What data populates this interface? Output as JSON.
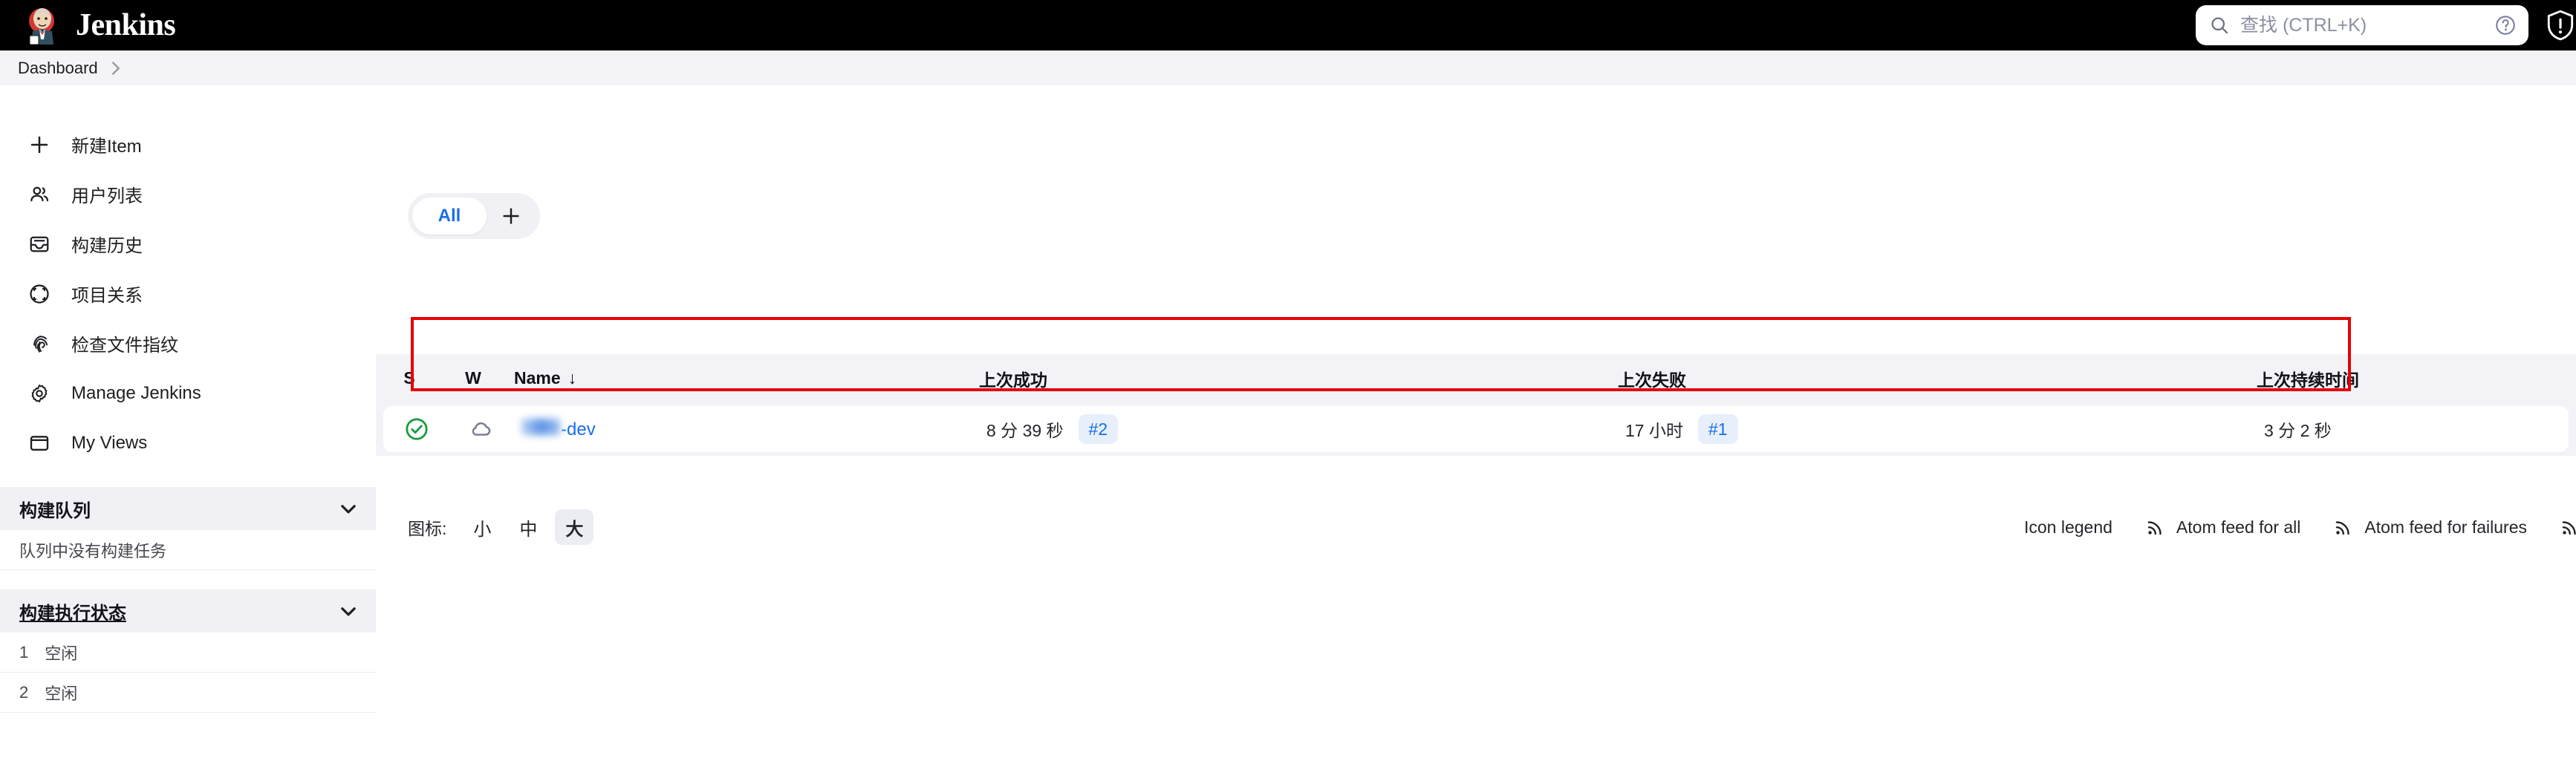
{
  "header": {
    "brand_name": "Jenkins",
    "logo_icon": "jenkins-butler-logo",
    "search": {
      "placeholder": "查找 (CTRL+K)",
      "value": "",
      "search_icon": "search-icon",
      "help_icon": "question-mark-circle-icon"
    },
    "security_icon": "shield-exclamation-icon"
  },
  "breadcrumb": {
    "items": [
      "Dashboard"
    ],
    "separator_icon": "chevron-right-icon"
  },
  "sidebar": {
    "items": [
      {
        "label": "新建Item",
        "icon": "plus-icon"
      },
      {
        "label": "用户列表",
        "icon": "people-icon"
      },
      {
        "label": "构建历史",
        "icon": "inbox-tray-icon"
      },
      {
        "label": "项目关系",
        "icon": "focus-frame-icon"
      },
      {
        "label": "检查文件指纹",
        "icon": "fingerprint-icon"
      },
      {
        "label": "Manage Jenkins",
        "icon": "gear-icon"
      },
      {
        "label": "My Views",
        "icon": "window-icon"
      }
    ],
    "build_queue": {
      "title": "构建队列",
      "collapse_icon": "chevron-down-icon",
      "empty_text": "队列中没有构建任务"
    },
    "executor_status": {
      "title": "构建执行状态",
      "collapse_icon": "chevron-down-icon",
      "executors": [
        {
          "number": "1",
          "status": "空闲"
        },
        {
          "number": "2",
          "status": "空闲"
        }
      ]
    }
  },
  "main": {
    "view_tabs": [
      {
        "label": "All",
        "active": true
      }
    ],
    "add_view_icon": "plus-icon",
    "jobs_table": {
      "columns": [
        {
          "key": "s",
          "label": "S"
        },
        {
          "key": "w",
          "label": "W"
        },
        {
          "key": "name",
          "label": "Name",
          "sort_indicator": "↓"
        },
        {
          "key": "last_success",
          "label": "上次成功"
        },
        {
          "key": "last_failure",
          "label": "上次失败"
        },
        {
          "key": "last_duration",
          "label": "上次持续时间"
        }
      ],
      "rows": [
        {
          "status_icon": "build-success-check-icon",
          "weather_icon": "weather-cloudy-icon",
          "name_redacted": true,
          "name_suffix": "-dev",
          "last_success_time": "8 分 39 秒",
          "last_success_build": "#2",
          "last_failure_time": "17 小时",
          "last_failure_build": "#1",
          "last_duration": "3 分 2 秒"
        }
      ]
    },
    "footer": {
      "icon_size_label": "图标:",
      "icon_sizes": [
        {
          "label": "小",
          "active": false
        },
        {
          "label": "中",
          "active": false
        },
        {
          "label": "大",
          "active": true
        }
      ],
      "links": [
        {
          "label": "Icon legend",
          "icon": null
        },
        {
          "label": "Atom feed for all",
          "icon": "rss-icon"
        },
        {
          "label": "Atom feed for failures",
          "icon": "rss-icon"
        }
      ],
      "trailing_icon": "rss-icon"
    }
  },
  "annotation": {
    "highlight_color": "#e60000"
  }
}
